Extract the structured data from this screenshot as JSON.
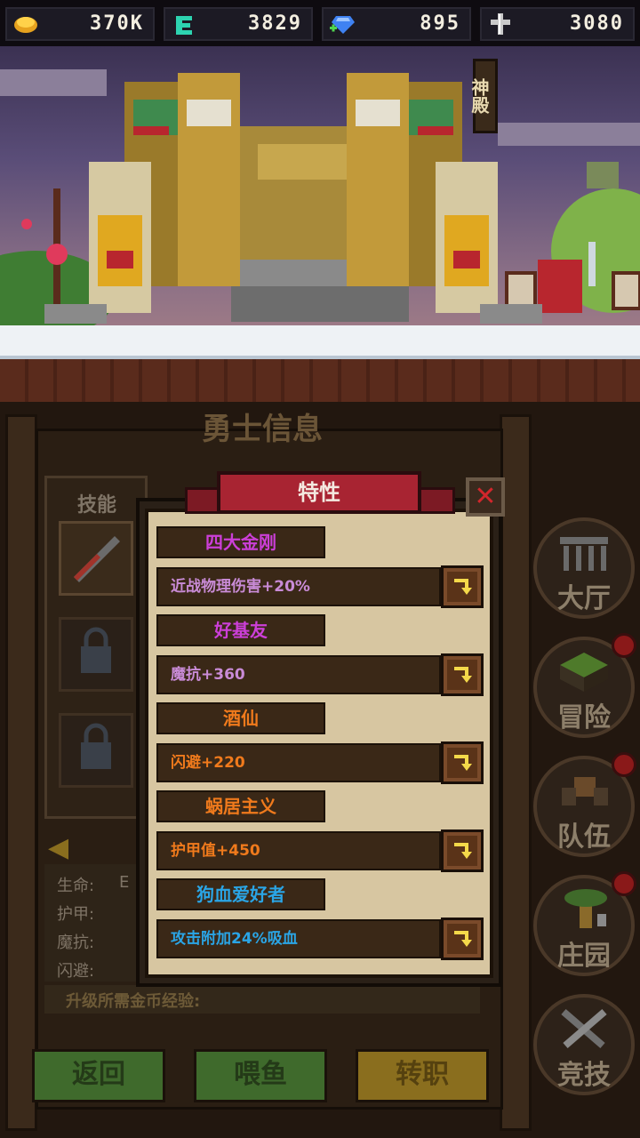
{
  "resources": [
    {
      "icon": "gold-coins-icon",
      "value": "370K"
    },
    {
      "icon": "green-rune-icon",
      "value": "3829"
    },
    {
      "icon": "blue-gem-icon",
      "value": "895"
    },
    {
      "icon": "cross-medal-icon",
      "value": "3080"
    }
  ],
  "scene": {
    "temple_sign": "神殿"
  },
  "panel": {
    "title": "勇士信息",
    "skills_label": "技能",
    "stats": [
      "生命:",
      "护甲:",
      "魔抗:",
      "闪避:"
    ],
    "stat_partial": "E",
    "exp_label": "升级所需金币经验:"
  },
  "dialog": {
    "title": "特性",
    "close_symbol": "✕",
    "traits": [
      {
        "name": "四大金刚",
        "desc": "近战物理伤害+20%",
        "name_color": "#cc3fd8",
        "desc_color": "#c98bd7"
      },
      {
        "name": "好基友",
        "desc": "魔抗+360",
        "name_color": "#cc3fd8",
        "desc_color": "#c98bd7"
      },
      {
        "name": "酒仙",
        "desc": "闪避+220",
        "name_color": "#f07a1c",
        "desc_color": "#f07a1c"
      },
      {
        "name": "蜗居主义",
        "desc": "护甲值+450",
        "name_color": "#f07a1c",
        "desc_color": "#f07a1c"
      },
      {
        "name": "狗血爱好者",
        "desc": "攻击附加24%吸血",
        "name_color": "#2aa5e6",
        "desc_color": "#2aa5e6"
      }
    ]
  },
  "menu": [
    {
      "label": "大厅",
      "icon": "hall-icon",
      "alert": false
    },
    {
      "label": "冒险",
      "icon": "adventure-icon",
      "alert": true
    },
    {
      "label": "队伍",
      "icon": "team-icon",
      "alert": true
    },
    {
      "label": "庄园",
      "icon": "manor-icon",
      "alert": true
    },
    {
      "label": "竞技",
      "icon": "arena-swords-icon",
      "alert": false
    }
  ],
  "buttons": [
    {
      "label": "返回",
      "color": "#3f6a2c"
    },
    {
      "label": "喂鱼",
      "color": "#3f6a2c"
    },
    {
      "label": "转职",
      "color": "#8a6e1e"
    }
  ]
}
